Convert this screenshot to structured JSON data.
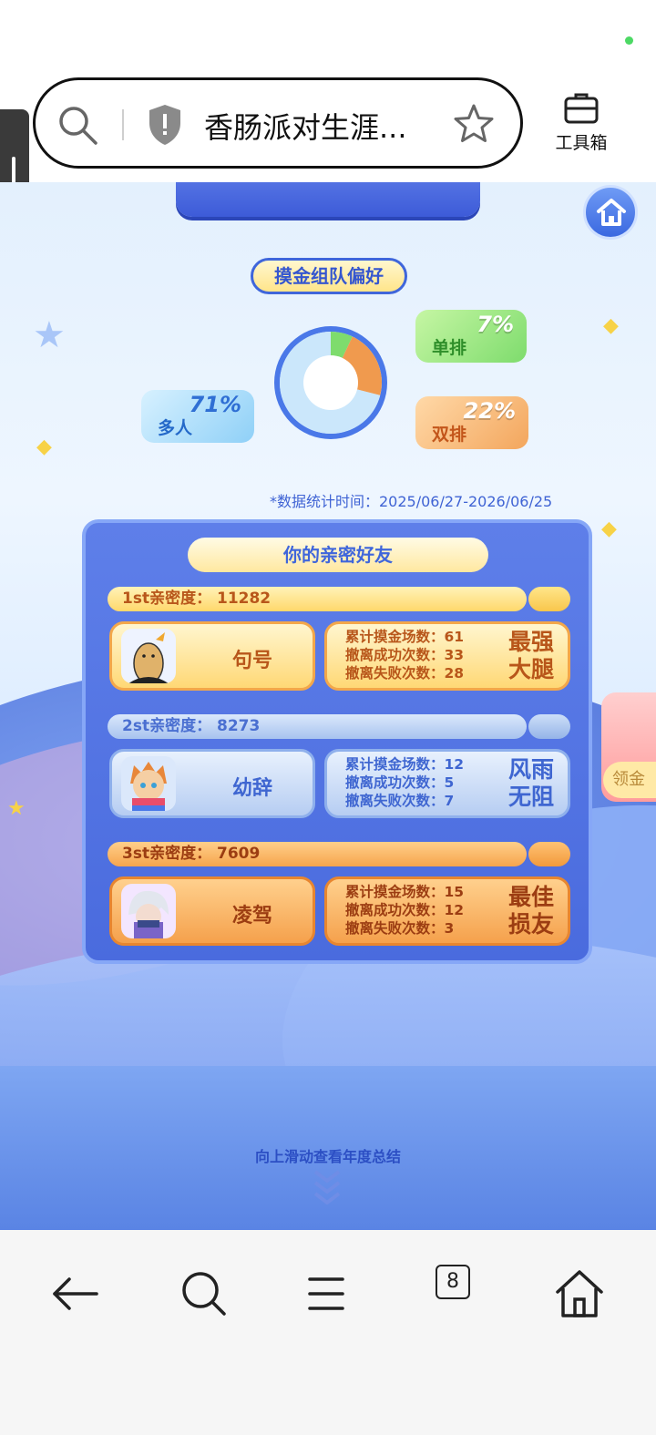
{
  "browser": {
    "url_text": "香肠派对生涯...",
    "toolbox_label": "工具箱",
    "tab_count": "8"
  },
  "page": {
    "pref_title": "摸金组队偏好",
    "modes": [
      {
        "label": "单排",
        "percent": "7%",
        "value": 7,
        "color": "#7edc6d"
      },
      {
        "label": "双排",
        "percent": "22%",
        "value": 22,
        "color": "#f09a4e"
      },
      {
        "label": "多人",
        "percent": "71%",
        "value": 71,
        "color": "#cbe7fb"
      }
    ],
    "stat_time": "*数据统计时间：2025/06/27-2026/06/25",
    "friends_title": "你的亲密好友",
    "friends": [
      {
        "rank_line": "1st亲密度：  11282",
        "name": "句号",
        "stats": [
          "累计摸金场数：61",
          "撤离成功次数：33",
          "撤离失败次数：28"
        ],
        "tag": "最强大腿"
      },
      {
        "rank_line": "2st亲密度：  8273",
        "name": "幼辞",
        "stats": [
          "累计摸金场数：12",
          "撤离成功次数：5",
          "撤离失败次数：7"
        ],
        "tag": "风雨无阻"
      },
      {
        "rank_line": "3st亲密度：  7609",
        "name": "凌驾",
        "stats": [
          "累计摸金场数：15",
          "撤离成功次数：12",
          "撤离失败次数：3"
        ],
        "tag": "最佳损友"
      }
    ],
    "side_card_label": "领金",
    "swipe_hint": "向上滑动查看年度总结"
  },
  "colors": {
    "accent_blue": "#3f66db",
    "donut_ring": "#4a78e8"
  }
}
